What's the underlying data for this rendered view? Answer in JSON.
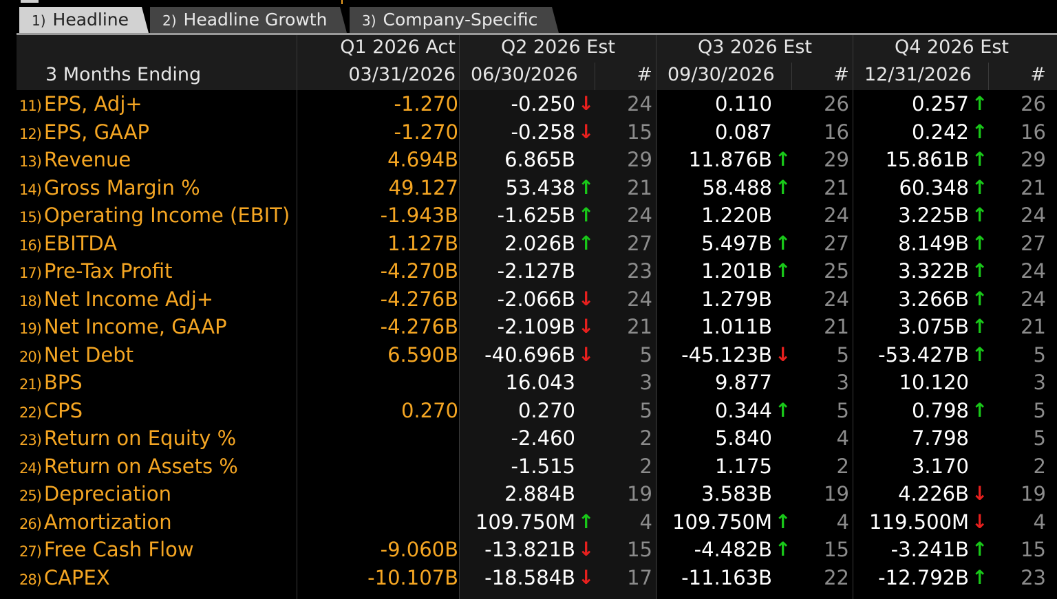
{
  "tabs": [
    {
      "num": "1)",
      "label": "Headline",
      "active": true
    },
    {
      "num": "2)",
      "label": "Headline Growth",
      "active": false
    },
    {
      "num": "3)",
      "label": "Company-Specific",
      "active": false
    }
  ],
  "header": {
    "row_label": "3 Months Ending",
    "count_symbol": "#",
    "columns": [
      {
        "period": "Q1 2026 Act",
        "date": "03/31/2026"
      },
      {
        "period": "Q2 2026 Est",
        "date": "06/30/2026"
      },
      {
        "period": "Q3 2026 Est",
        "date": "09/30/2026"
      },
      {
        "period": "Q4 2026 Est",
        "date": "12/31/2026"
      }
    ]
  },
  "colors": {
    "label": "#f5a623",
    "up": "#19c819",
    "down": "#e8201e",
    "count": "#8c8c8c"
  },
  "rows": [
    {
      "num": "11)",
      "label": "EPS, Adj+",
      "q1": "-1.270",
      "q2": "-0.250",
      "q2a": "down",
      "q2n": "24",
      "q3": "0.110",
      "q3a": "",
      "q3n": "26",
      "q4": "0.257",
      "q4a": "up",
      "q4n": "26"
    },
    {
      "num": "12)",
      "label": "EPS, GAAP",
      "q1": "-1.270",
      "q2": "-0.258",
      "q2a": "down",
      "q2n": "15",
      "q3": "0.087",
      "q3a": "",
      "q3n": "16",
      "q4": "0.242",
      "q4a": "up",
      "q4n": "16"
    },
    {
      "num": "13)",
      "label": "Revenue",
      "q1": "4.694B",
      "q2": "6.865B",
      "q2a": "",
      "q2n": "29",
      "q3": "11.876B",
      "q3a": "up",
      "q3n": "29",
      "q4": "15.861B",
      "q4a": "up",
      "q4n": "29"
    },
    {
      "num": "14)",
      "label": "Gross Margin %",
      "q1": "49.127",
      "q2": "53.438",
      "q2a": "up",
      "q2n": "21",
      "q3": "58.488",
      "q3a": "up",
      "q3n": "21",
      "q4": "60.348",
      "q4a": "up",
      "q4n": "21"
    },
    {
      "num": "15)",
      "label": "Operating Income (EBIT)",
      "q1": "-1.943B",
      "q2": "-1.625B",
      "q2a": "up",
      "q2n": "24",
      "q3": "1.220B",
      "q3a": "",
      "q3n": "24",
      "q4": "3.225B",
      "q4a": "up",
      "q4n": "24"
    },
    {
      "num": "16)",
      "label": "EBITDA",
      "q1": "1.127B",
      "q2": "2.026B",
      "q2a": "up",
      "q2n": "27",
      "q3": "5.497B",
      "q3a": "up",
      "q3n": "27",
      "q4": "8.149B",
      "q4a": "up",
      "q4n": "27"
    },
    {
      "num": "17)",
      "label": "Pre-Tax Profit",
      "q1": "-4.270B",
      "q2": "-2.127B",
      "q2a": "",
      "q2n": "23",
      "q3": "1.201B",
      "q3a": "up",
      "q3n": "25",
      "q4": "3.322B",
      "q4a": "up",
      "q4n": "24"
    },
    {
      "num": "18)",
      "label": "Net Income Adj+",
      "q1": "-4.276B",
      "q2": "-2.066B",
      "q2a": "down",
      "q2n": "24",
      "q3": "1.279B",
      "q3a": "",
      "q3n": "24",
      "q4": "3.266B",
      "q4a": "up",
      "q4n": "24"
    },
    {
      "num": "19)",
      "label": "Net Income, GAAP",
      "q1": "-4.276B",
      "q2": "-2.109B",
      "q2a": "down",
      "q2n": "21",
      "q3": "1.011B",
      "q3a": "",
      "q3n": "21",
      "q4": "3.075B",
      "q4a": "up",
      "q4n": "21"
    },
    {
      "num": "20)",
      "label": "Net Debt",
      "q1": "6.590B",
      "q2": "-40.696B",
      "q2a": "down",
      "q2n": "5",
      "q3": "-45.123B",
      "q3a": "down",
      "q3n": "5",
      "q4": "-53.427B",
      "q4a": "up",
      "q4n": "5"
    },
    {
      "num": "21)",
      "label": "BPS",
      "q1": "",
      "q2": "16.043",
      "q2a": "",
      "q2n": "3",
      "q3": "9.877",
      "q3a": "",
      "q3n": "3",
      "q4": "10.120",
      "q4a": "",
      "q4n": "3"
    },
    {
      "num": "22)",
      "label": "CPS",
      "q1": "0.270",
      "q2": "0.270",
      "q2a": "",
      "q2n": "5",
      "q3": "0.344",
      "q3a": "up",
      "q3n": "5",
      "q4": "0.798",
      "q4a": "up",
      "q4n": "5"
    },
    {
      "num": "23)",
      "label": "Return on Equity %",
      "q1": "",
      "q2": "-2.460",
      "q2a": "",
      "q2n": "2",
      "q3": "5.840",
      "q3a": "",
      "q3n": "4",
      "q4": "7.798",
      "q4a": "",
      "q4n": "5"
    },
    {
      "num": "24)",
      "label": "Return on Assets %",
      "q1": "",
      "q2": "-1.515",
      "q2a": "",
      "q2n": "2",
      "q3": "1.175",
      "q3a": "",
      "q3n": "2",
      "q4": "3.170",
      "q4a": "",
      "q4n": "2"
    },
    {
      "num": "25)",
      "label": "Depreciation",
      "q1": "",
      "q2": "2.884B",
      "q2a": "",
      "q2n": "19",
      "q3": "3.583B",
      "q3a": "",
      "q3n": "19",
      "q4": "4.226B",
      "q4a": "down",
      "q4n": "19"
    },
    {
      "num": "26)",
      "label": "Amortization",
      "q1": "",
      "q2": "109.750M",
      "q2a": "up",
      "q2n": "4",
      "q3": "109.750M",
      "q3a": "up",
      "q3n": "4",
      "q4": "119.500M",
      "q4a": "down",
      "q4n": "4"
    },
    {
      "num": "27)",
      "label": "Free Cash Flow",
      "q1": "-9.060B",
      "q2": "-13.821B",
      "q2a": "down",
      "q2n": "15",
      "q3": "-4.482B",
      "q3a": "up",
      "q3n": "15",
      "q4": "-3.241B",
      "q4a": "up",
      "q4n": "15"
    },
    {
      "num": "28)",
      "label": "CAPEX",
      "q1": "-10.107B",
      "q2": "-18.584B",
      "q2a": "down",
      "q2n": "17",
      "q3": "-11.163B",
      "q3a": "",
      "q3n": "22",
      "q4": "-12.792B",
      "q4a": "up",
      "q4n": "23"
    }
  ]
}
